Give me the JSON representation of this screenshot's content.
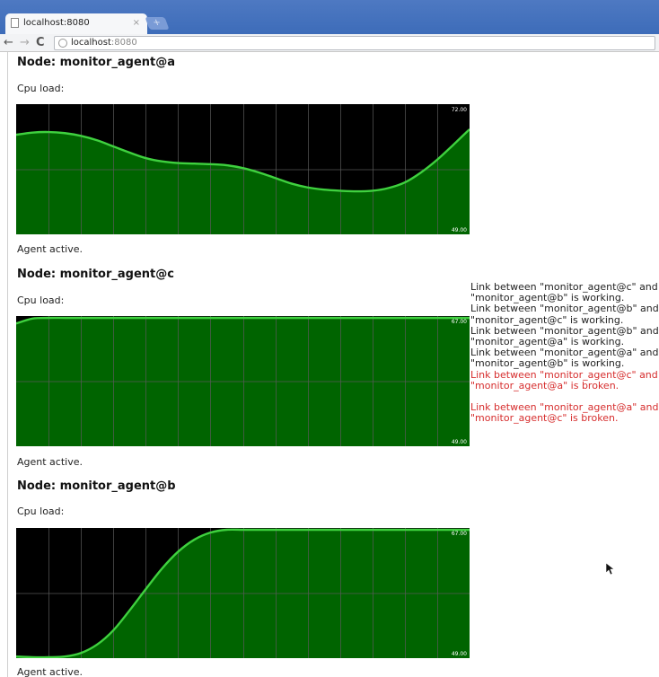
{
  "browser": {
    "tab_title": "localhost:8080",
    "tab_close": "×",
    "new_tab": "+",
    "back": "←",
    "forward": "→",
    "reload": "C",
    "url_host": "localhost",
    "url_port": ":8080"
  },
  "nodes": [
    {
      "title": "Node: monitor_agent@a",
      "cpu_label": "Cpu load:",
      "status": "Agent active.",
      "max_label": "72.00",
      "min_label": "49.00"
    },
    {
      "title": "Node: monitor_agent@c",
      "cpu_label": "Cpu load:",
      "status": "Agent active.",
      "max_label": "67.00",
      "min_label": "49.00"
    },
    {
      "title": "Node: monitor_agent@b",
      "cpu_label": "Cpu load:",
      "status": "Agent active.",
      "max_label": "67.00",
      "min_label": "49.00"
    }
  ],
  "links": [
    {
      "text": "Link between \"monitor_agent@c\" and \"monitor_agent@b\" is working.",
      "state": "working"
    },
    {
      "text": "Link between \"monitor_agent@b\" and \"monitor_agent@c\" is working.",
      "state": "working"
    },
    {
      "text": "Link between \"monitor_agent@b\" and \"monitor_agent@a\" is working.",
      "state": "working"
    },
    {
      "text": "Link between \"monitor_agent@a\" and \"monitor_agent@b\" is working.",
      "state": "working"
    },
    {
      "text": "Link between \"monitor_agent@c\" and \"monitor_agent@a\" is broken.",
      "state": "broken"
    },
    {
      "text": "Link between \"monitor_agent@a\" and \"monitor_agent@c\" is broken.",
      "state": "broken"
    }
  ],
  "colors": {
    "chart_bg": "#000000",
    "chart_fill": "#006400",
    "chart_line": "#3fd13f",
    "grid": "#5a5a5a",
    "broken": "#d62d2d"
  },
  "chart_data": [
    {
      "type": "area",
      "title": "Node: monitor_agent@a",
      "ylim": [
        49,
        72
      ],
      "grid": true,
      "max_label": "72.00",
      "min_label": "49.00",
      "x": [
        0,
        1,
        2,
        3,
        4,
        5,
        6,
        7,
        8,
        9,
        10,
        11,
        12,
        13,
        14,
        15,
        16,
        17,
        18,
        19,
        20,
        21,
        22,
        23,
        24,
        25,
        26,
        27,
        28
      ],
      "series": [
        {
          "values": [
            66.8,
            67.2,
            67.3,
            67.1,
            66.6,
            65.8,
            64.7,
            63.6,
            62.6,
            62.0,
            61.7,
            61.6,
            61.5,
            61.3,
            60.8,
            60.0,
            59.0,
            58.0,
            57.3,
            56.9,
            56.7,
            56.6,
            56.7,
            57.2,
            58.2,
            60.0,
            62.3,
            65.0,
            67.8
          ]
        }
      ]
    },
    {
      "type": "area",
      "title": "Node: monitor_agent@c",
      "ylim": [
        49,
        67
      ],
      "grid": true,
      "max_label": "67.00",
      "min_label": "49.00",
      "x": [
        0,
        1,
        2,
        3,
        4,
        5,
        6,
        7,
        8,
        9,
        10,
        11,
        12,
        13,
        14,
        15,
        16,
        17,
        18,
        19,
        20,
        21,
        22,
        23,
        24,
        25,
        26,
        27,
        28
      ],
      "series": [
        {
          "values": [
            66.2,
            66.9,
            67.0,
            67.0,
            67.0,
            67.0,
            67.0,
            67.0,
            67.0,
            67.0,
            67.0,
            67.0,
            67.0,
            67.0,
            67.0,
            67.0,
            67.0,
            67.0,
            67.0,
            67.0,
            67.0,
            67.0,
            67.0,
            67.0,
            67.0,
            67.0,
            67.0,
            67.0,
            67.0
          ]
        }
      ]
    },
    {
      "type": "area",
      "title": "Node: monitor_agent@b",
      "ylim": [
        49,
        67
      ],
      "grid": true,
      "max_label": "67.00",
      "min_label": "49.00",
      "x": [
        0,
        1,
        2,
        3,
        4,
        5,
        6,
        7,
        8,
        9,
        10,
        11,
        12,
        13,
        14,
        15,
        16,
        17,
        18,
        19,
        20,
        21,
        22,
        23,
        24,
        25,
        26,
        27,
        28
      ],
      "series": [
        {
          "values": [
            49.1,
            49.0,
            49.0,
            49.1,
            49.6,
            50.8,
            52.8,
            55.6,
            58.6,
            61.5,
            63.9,
            65.6,
            66.6,
            67.0,
            67.0,
            67.0,
            67.0,
            67.0,
            67.0,
            67.0,
            67.0,
            67.0,
            67.0,
            67.0,
            67.0,
            67.0,
            67.0,
            67.0,
            67.0
          ]
        }
      ]
    }
  ]
}
